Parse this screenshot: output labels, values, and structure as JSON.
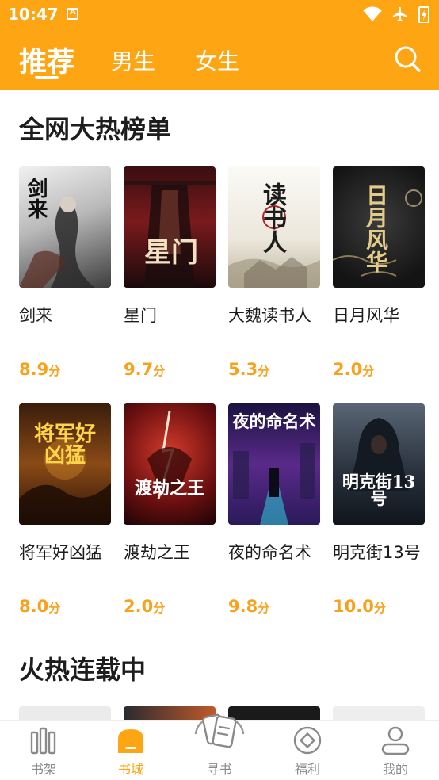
{
  "status_bar": {
    "time": "10:47",
    "notification_glyph": "A",
    "icons": [
      "wifi-icon",
      "airplane-mode-icon",
      "battery-charging-icon"
    ]
  },
  "header": {
    "background_color": "#fea514",
    "tabs": [
      {
        "label": "推荐",
        "active": true
      },
      {
        "label": "男生",
        "active": false
      },
      {
        "label": "女生",
        "active": false
      }
    ],
    "search_icon": "search-icon"
  },
  "sections": [
    {
      "title": "全网大热榜单",
      "books": [
        {
          "name": "剑来",
          "score": "8.9",
          "unit": "分",
          "cover_text": "剑来",
          "cover_colors": [
            "#e9e9e9",
            "#7a7a7a"
          ]
        },
        {
          "name": "星门",
          "score": "9.7",
          "unit": "分",
          "cover_text": "星门",
          "cover_colors": [
            "#5a1416",
            "#14090b"
          ]
        },
        {
          "name": "大魏读书人",
          "score": "5.3",
          "unit": "分",
          "cover_text": "读书人",
          "cover_colors": [
            "#f4f1ea",
            "#cfc8b6"
          ]
        },
        {
          "name": "日月风华",
          "score": "2.0",
          "unit": "分",
          "cover_text": "日月风华",
          "cover_colors": [
            "#2b2b2b",
            "#111111"
          ]
        },
        {
          "name": "将军好凶猛",
          "score": "8.0",
          "unit": "分",
          "cover_text": "将军好凶猛",
          "cover_colors": [
            "#6e3a14",
            "#2a1508"
          ]
        },
        {
          "name": "渡劫之王",
          "score": "2.0",
          "unit": "分",
          "cover_text": "渡劫之王",
          "cover_colors": [
            "#8b1516",
            "#2a0608"
          ]
        },
        {
          "name": "夜的命名术",
          "score": "9.8",
          "unit": "分",
          "cover_text": "夜的命名术",
          "cover_colors": [
            "#5a2a8a",
            "#1b1040"
          ]
        },
        {
          "name": "明克街13号",
          "score": "10.0",
          "unit": "分",
          "cover_text": "明克街13号",
          "cover_colors": [
            "#3a4a5e",
            "#131a24"
          ]
        }
      ]
    },
    {
      "title": "火热连载中"
    }
  ],
  "bottom_nav": [
    {
      "label": "书架",
      "icon": "bookshelf-icon",
      "active": false
    },
    {
      "label": "书城",
      "icon": "bookstore-icon",
      "active": true
    },
    {
      "label": "寻书",
      "icon": "find-book-icon",
      "active": false
    },
    {
      "label": "福利",
      "icon": "welfare-icon",
      "active": false
    },
    {
      "label": "我的",
      "icon": "profile-icon",
      "active": false
    }
  ],
  "accent_color": "#fea514",
  "score_color": "#f8a21c"
}
